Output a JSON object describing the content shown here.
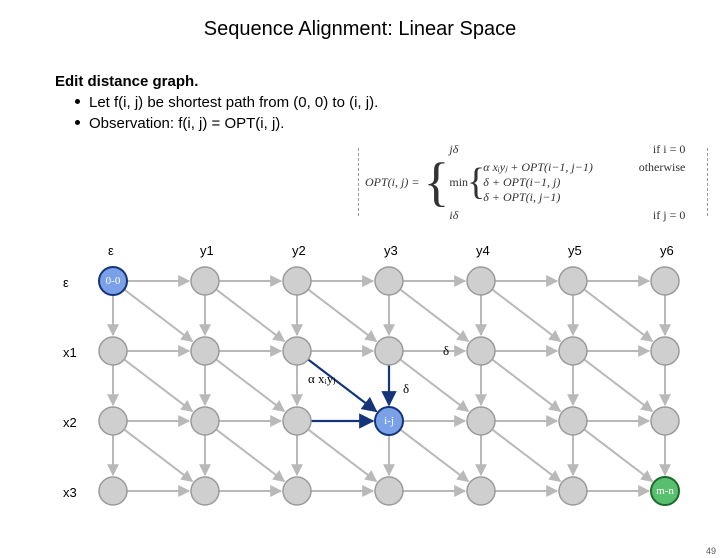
{
  "title": "Sequence Alignment: Linear Space",
  "heading": "Edit distance graph.",
  "bullets": [
    "Let f(i, j) be shortest path from (0, 0) to (i, j).",
    "Observation:  f(i, j) = OPT(i, j)."
  ],
  "formula": {
    "lhs": "OPT(i, j) = ",
    "case1_lhs": "jδ",
    "case1_cond": "if i = 0",
    "middle_min": "min",
    "mid_a": "α xᵢyⱼ + OPT(i−1, j−1)",
    "mid_b": "δ + OPT(i−1, j)",
    "mid_c": "δ + OPT(i, j−1)",
    "case2_cond": "otherwise",
    "case3_lhs": "iδ",
    "case3_cond": "if j = 0"
  },
  "columns": [
    "ε",
    "y1",
    "y2",
    "y3",
    "y4",
    "y5",
    "y6"
  ],
  "rows": [
    "ε",
    "x1",
    "x2",
    "x3"
  ],
  "node00_label": "0-0",
  "node_ij_label": "i-j",
  "node_mn_label": "m-n",
  "delta_h": "δ",
  "delta_v": "δ",
  "alpha_diag": "α xᵢyⱼ",
  "slide_number": "49",
  "chart_data": {
    "type": "diagram",
    "grid_rows": 4,
    "grid_cols": 7,
    "special_nodes": [
      {
        "row": 0,
        "col": 0,
        "label": "0-0",
        "color": "blue"
      },
      {
        "row": 2,
        "col": 3,
        "label": "i-j",
        "color": "blue"
      },
      {
        "row": 3,
        "col": 6,
        "label": "m-n",
        "color": "green"
      }
    ],
    "highlighted_edges": [
      {
        "from": [
          1,
          2
        ],
        "to": [
          2,
          3
        ],
        "label": "α xᵢyⱼ",
        "dir": "diag"
      },
      {
        "from": [
          1,
          3
        ],
        "to": [
          2,
          3
        ],
        "label": "δ",
        "dir": "vert"
      },
      {
        "from": [
          2,
          2
        ],
        "to": [
          2,
          3
        ],
        "label": "δ",
        "dir": "horiz (implied)"
      }
    ],
    "row_labels": [
      "ε",
      "x1",
      "x2",
      "x3"
    ],
    "col_labels": [
      "ε",
      "y1",
      "y2",
      "y3",
      "y4",
      "y5",
      "y6"
    ]
  }
}
